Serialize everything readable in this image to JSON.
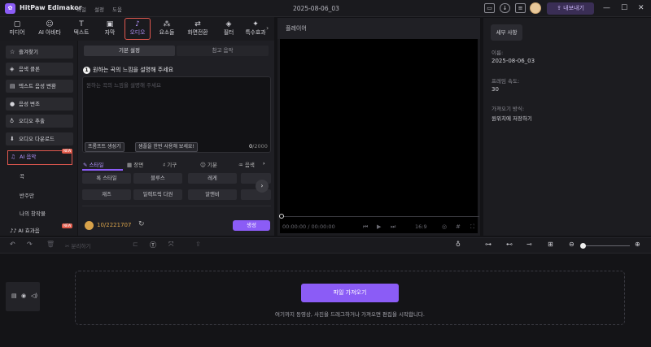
{
  "app": {
    "name": "HitPaw Edimakor",
    "menu": [
      "파일",
      "설정",
      "도움"
    ],
    "project_title": "2025-08-06_03",
    "export_label": "내보내기",
    "brand_color": "#8b5cf6"
  },
  "tabs": [
    {
      "label": "미디어",
      "icon": "media-icon"
    },
    {
      "label": "AI 아바타",
      "icon": "ai-icon"
    },
    {
      "label": "텍스트",
      "icon": "text-icon"
    },
    {
      "label": "자막",
      "icon": "subtitle-icon"
    },
    {
      "label": "오디오",
      "icon": "music-note-icon",
      "active": true
    },
    {
      "label": "요소들",
      "icon": "elements-icon"
    },
    {
      "label": "화면전환",
      "icon": "transition-icon"
    },
    {
      "label": "필터",
      "icon": "filter-icon"
    },
    {
      "label": "특수효과",
      "icon": "effects-icon"
    }
  ],
  "sidebar": {
    "items": [
      {
        "label": "즐겨찾기",
        "icon": "star-icon"
      },
      {
        "label": "음색 클론",
        "icon": "clone-icon"
      },
      {
        "label": "텍스트 음성 변환",
        "icon": "tts-icon"
      },
      {
        "label": "음성 변조",
        "icon": "voice-changer-icon"
      },
      {
        "label": "오디오 추출",
        "icon": "mic-icon"
      },
      {
        "label": "오디오 다운로드",
        "icon": "download-icon"
      }
    ],
    "active_item": "AI 음악",
    "active_badge": "NEW",
    "subitems": [
      "곡",
      "반주만",
      "나의 창작물"
    ],
    "bottom_item": "AI 효과음",
    "bottom_badge": "NEW"
  },
  "panel": {
    "seg_basic": "기본 설정",
    "seg_ref": "참고 음악",
    "step_num": "1",
    "step_title": "원하는 곡의 느낌을 설명해 주세요",
    "textarea_placeholder": "원하는 곡의 느낌을 설명해 주세요",
    "prompt_btn": "프롬프트 생성기",
    "sample_btn": "샘플을 한번 사용해 보세요!",
    "counter_current": "0",
    "counter_max": "/2000",
    "style_tabs": [
      "스타일",
      "장면",
      "기구",
      "기분",
      "음색"
    ],
    "chips": [
      "록 스타일",
      "블루스",
      "레게",
      "재즈",
      "일렉트릭 다원",
      "알앤비"
    ],
    "credits": "10/2221707",
    "generate": "생성"
  },
  "player": {
    "header": "플레이어",
    "time": "00:00:00 / 00:00:00",
    "ratio": "16:9"
  },
  "details": {
    "tab": "세부 사항",
    "name_label": "이름:",
    "name_value": "2025-08-06_03",
    "fps_label": "프레임 속도:",
    "fps_value": "30",
    "save_label": "가져오기 방식:",
    "save_value": "원위치에 저장하기"
  },
  "timeline": {
    "split_label": "분리하기",
    "load_button": "파일 가져오기",
    "hint": "여기까지 동영상, 사진을 드래그하거나 가져오면 편집을 시작합니다."
  }
}
